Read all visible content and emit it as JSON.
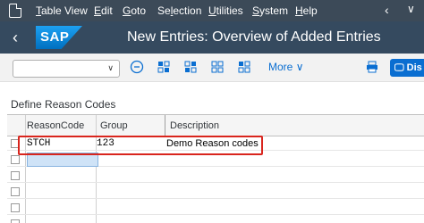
{
  "menubar": {
    "items": [
      {
        "label": "Table View",
        "ul": "T"
      },
      {
        "label": "Edit",
        "ul": "E"
      },
      {
        "label": "Goto",
        "ul": "G"
      },
      {
        "label": "Selection",
        "ul": "l"
      },
      {
        "label": "Utilities",
        "ul": "U"
      },
      {
        "label": "System",
        "ul": "S"
      },
      {
        "label": "Help",
        "ul": "H"
      }
    ],
    "icons": [
      "document-icon",
      "chevron-left-icon",
      "chevron-down-icon"
    ]
  },
  "shell": {
    "logo_text": "SAP",
    "title": "New Entries: Overview of Added Entries",
    "back_icon": "chevron-left-icon"
  },
  "toolbar": {
    "command_field_value": "",
    "icons": [
      "minus-circle-icon",
      "select-all-icon",
      "select-block-icon",
      "deselect-all-icon",
      "print-icon"
    ],
    "more_label": "More",
    "display_label": "Dis"
  },
  "section": {
    "title": "Define Reason Codes"
  },
  "table": {
    "columns": [
      "ReasonCode",
      "Group",
      "Description"
    ],
    "rows": [
      {
        "reason_code": "STCH",
        "group": "123",
        "description": "Demo Reason codes"
      },
      {
        "reason_code": "",
        "group": "",
        "description": ""
      },
      {
        "reason_code": "",
        "group": "",
        "description": ""
      },
      {
        "reason_code": "",
        "group": "",
        "description": ""
      },
      {
        "reason_code": "",
        "group": "",
        "description": ""
      },
      {
        "reason_code": "",
        "group": "",
        "description": ""
      }
    ]
  },
  "colors": {
    "menubar_bg": "#3c4a58",
    "shell_bg": "#354a5f",
    "accent": "#0a6ed1",
    "highlight_border": "#d9251d"
  }
}
